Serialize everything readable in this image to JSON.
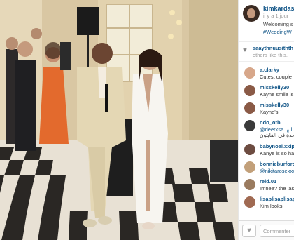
{
  "post": {
    "username": "kimkardashian",
    "time_ago": "il y a 1 jour",
    "caption": "Welcoming s",
    "hashtag": "#WeddingW"
  },
  "likes": {
    "names": "saaythnuusithth",
    "sub": "others like this."
  },
  "comments": [
    {
      "user": "a.clarky",
      "text": "Cutest couple",
      "text_link": false,
      "avatar_color": "#d7a78a"
    },
    {
      "user": "misskelly30",
      "text": "Kayne smile is",
      "text_link": false,
      "avatar_color": "#8a5a46"
    },
    {
      "user": "misskelly30",
      "text": "Kayne's",
      "text_link": false,
      "avatar_color": "#8a5a46"
    },
    {
      "user": "ndo_otb",
      "text": "@deerksa الها",
      "text_link": true,
      "avatar_color": "#3a3a3a"
    },
    {
      "user": "",
      "text": "وحدة في الفايتون",
      "text_link": false,
      "avatar_color": ""
    },
    {
      "user": "babynoel.xxlp",
      "text": "Kanye is so ha",
      "text_link": false,
      "avatar_color": "#6d4c41"
    },
    {
      "user": "bonnieburford",
      "text": "@nikitarosexxx",
      "text_link": true,
      "avatar_color": "#c2a07a"
    },
    {
      "user": "reid.01",
      "text": "Imnee? the las",
      "text_link": false,
      "avatar_color": "#9a7b5f"
    },
    {
      "user": "lisaplisaplisap",
      "text": "Kim looks",
      "text_link": false,
      "avatar_color": "#a06a52"
    }
  ],
  "footer": {
    "comment_placeholder": "Commenter"
  },
  "icons": {
    "like": "heart-icon",
    "photo": "wedding-photo"
  }
}
